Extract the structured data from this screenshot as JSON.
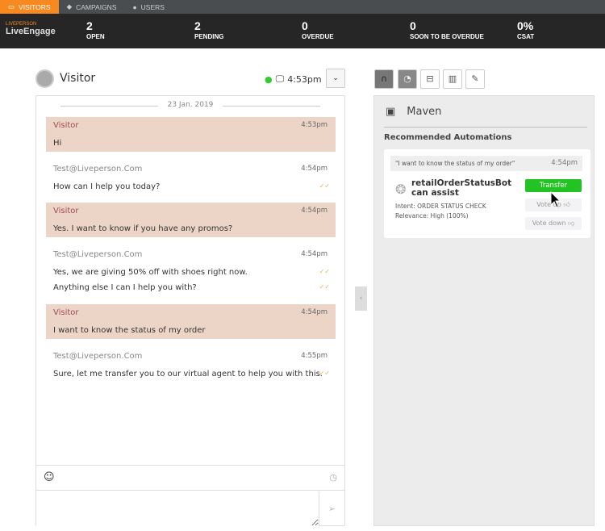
{
  "nav": {
    "tabs": [
      {
        "label": "VISITORS",
        "icon": "chat-icon",
        "active": true
      },
      {
        "label": "CAMPAIGNS",
        "icon": "tag-icon"
      },
      {
        "label": "USERS",
        "icon": "user-icon"
      }
    ]
  },
  "brand": {
    "small": "LIVEPERSON",
    "name": "LiveEngage"
  },
  "stats": [
    {
      "value": "2",
      "label": "OPEN"
    },
    {
      "value": "2",
      "label": "PENDING"
    },
    {
      "value": "0",
      "label": "OVERDUE"
    },
    {
      "value": "0",
      "label": "SOON TO BE OVERDUE"
    },
    {
      "value": "0%",
      "label": "CSAT"
    }
  ],
  "visitor": {
    "name": "Visitor",
    "time": "4:53pm"
  },
  "chat": {
    "date": "23 Jan. 2019",
    "messages": [
      {
        "from": "Visitor",
        "time": "4:53pm",
        "lines": [
          "Hi"
        ]
      },
      {
        "from": "Test@Liveperson.Com",
        "time": "4:54pm",
        "lines": [
          "How can I help you today?"
        ]
      },
      {
        "from": "Visitor",
        "time": "4:54pm",
        "lines": [
          "Yes. I want to know if you have any promos?"
        ]
      },
      {
        "from": "Test@Liveperson.Com",
        "time": "4:54pm",
        "lines": [
          "Yes, we are giving 50% off with shoes right now.",
          "Anything else I can I help you with?"
        ]
      },
      {
        "from": "Visitor",
        "time": "4:54pm",
        "lines": [
          "I want to know the status of my order"
        ]
      },
      {
        "from": "Test@Liveperson.Com",
        "time": "4:55pm",
        "lines": [
          "Sure, let me transfer you to our virtual agent to help you with this."
        ]
      }
    ]
  },
  "maven": {
    "title": "Maven",
    "section": "Recommended Automations",
    "quote": "\"I want to know the status of my order\"",
    "quote_time": "4:54pm",
    "bot": "retailOrderStatusBot can assist",
    "intent": "Intent: ORDER STATUS CHECK",
    "relevance": "Relevance: High (100%)",
    "transfer": "Transfer",
    "vote_up": "Vote up",
    "vote_down": "Vote down"
  },
  "colors": {
    "accent": "#f7891f",
    "visitor_bubble": "#ecd5c6",
    "transfer": "#22c322"
  }
}
